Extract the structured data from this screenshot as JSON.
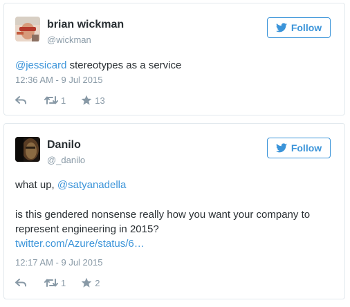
{
  "colors": {
    "accent": "#3b94d9",
    "text": "#292f33",
    "muted": "#8899a6",
    "border": "#e1e8ed"
  },
  "tweets": [
    {
      "user": {
        "name": "brian wickman",
        "handle": "@wickman"
      },
      "follow_label": "Follow",
      "text": {
        "mention": "@jessicard",
        "rest": " stereotypes as a service"
      },
      "timestamp": "12:36 AM - 9 Jul 2015",
      "retweets": "1",
      "favorites": "13",
      "icons": [
        "reply-icon",
        "retweet-icon",
        "star-icon",
        "bird-icon"
      ]
    },
    {
      "user": {
        "name": "Danilo",
        "handle": "@_danilo"
      },
      "follow_label": "Follow",
      "text": {
        "line1_prefix": "what up, ",
        "line1_mention": "@satyanadella",
        "paragraph2": "is this gendered nonsense really how you want your company to represent engineering in 2015?",
        "link": "twitter.com/Azure/status/6…"
      },
      "timestamp": "12:17 AM - 9 Jul 2015",
      "retweets": "1",
      "favorites": "2",
      "icons": [
        "reply-icon",
        "retweet-icon",
        "star-icon",
        "bird-icon"
      ]
    }
  ]
}
